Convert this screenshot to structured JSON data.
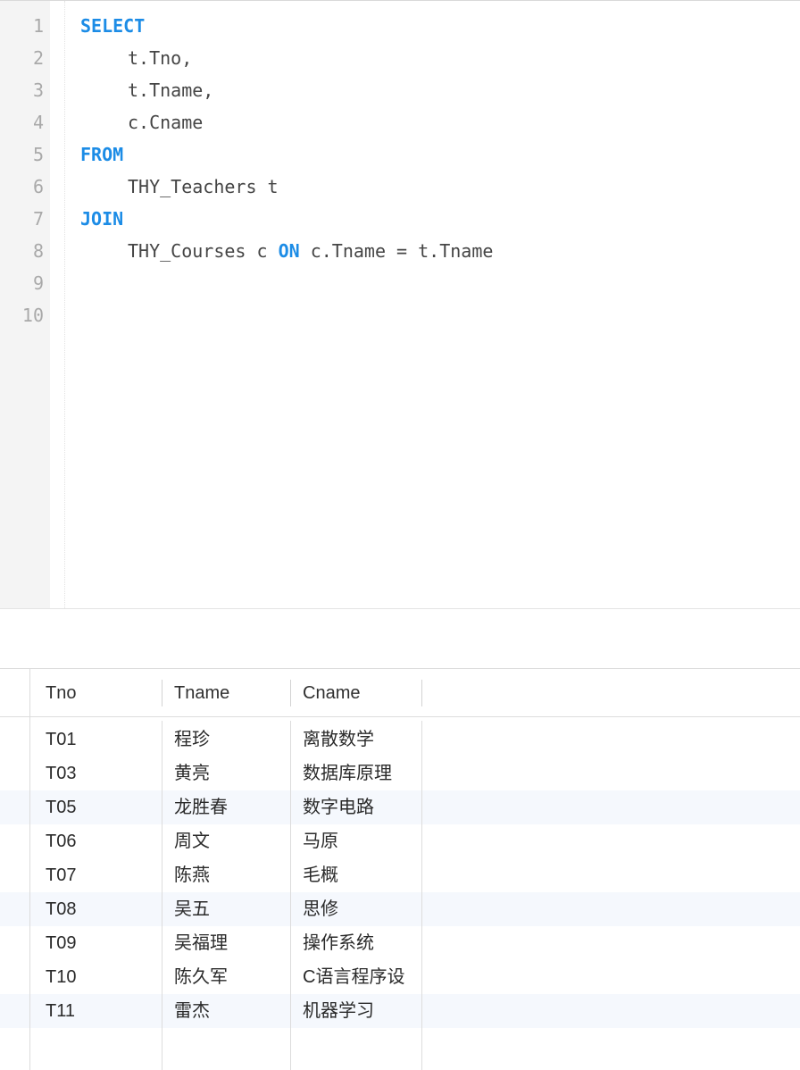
{
  "editor": {
    "line_numbers": [
      "1",
      "2",
      "3",
      "4",
      "5",
      "6",
      "7",
      "8",
      "9",
      "10"
    ],
    "lines": [
      {
        "indent": false,
        "parts": [
          {
            "kw": true,
            "text": "SELECT"
          }
        ]
      },
      {
        "indent": true,
        "parts": [
          {
            "kw": false,
            "text": "t.Tno,"
          }
        ]
      },
      {
        "indent": true,
        "parts": [
          {
            "kw": false,
            "text": "t.Tname,"
          }
        ]
      },
      {
        "indent": true,
        "parts": [
          {
            "kw": false,
            "text": "c.Cname"
          }
        ]
      },
      {
        "indent": false,
        "parts": [
          {
            "kw": true,
            "text": "FROM"
          }
        ]
      },
      {
        "indent": true,
        "parts": [
          {
            "kw": false,
            "text": "THY_Teachers t"
          }
        ]
      },
      {
        "indent": false,
        "parts": [
          {
            "kw": true,
            "text": "JOIN"
          }
        ]
      },
      {
        "indent": true,
        "parts": [
          {
            "kw": false,
            "text": "THY_Courses c "
          },
          {
            "kw": true,
            "text": "ON"
          },
          {
            "kw": false,
            "text": " c.Tname = t.Tname"
          }
        ]
      },
      {
        "indent": false,
        "parts": []
      },
      {
        "indent": false,
        "parts": []
      }
    ],
    "keyword_color": "#1c8ce6",
    "text_color": "#454545"
  },
  "results": {
    "columns": [
      "Tno",
      "Tname",
      "Cname"
    ],
    "rows": [
      [
        "T01",
        "程珍",
        "离散数学"
      ],
      [
        "T03",
        "黄亮",
        "数据库原理"
      ],
      [
        "T05",
        "龙胜春",
        "数字电路"
      ],
      [
        "T06",
        "周文",
        "马原"
      ],
      [
        "T07",
        "陈燕",
        "毛概"
      ],
      [
        "T08",
        "吴五",
        "思修"
      ],
      [
        "T09",
        "吴福理",
        "操作系统"
      ],
      [
        "T10",
        "陈久军",
        "C语言程序设"
      ],
      [
        "T11",
        "雷杰",
        "机器学习"
      ]
    ],
    "alt_row_color": "#f5f8fd"
  }
}
